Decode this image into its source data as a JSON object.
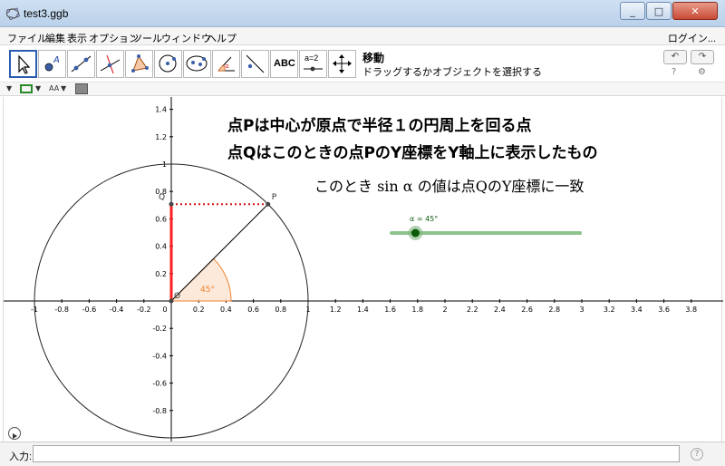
{
  "window": {
    "title": "test3.ggb",
    "minimize": "_",
    "maximize": "□",
    "close": "✕"
  },
  "menu": {
    "items": [
      "ファイル",
      "編集",
      "表示",
      "オプション",
      "ツール",
      "ウィンドウ",
      "ヘルプ"
    ],
    "login": "ログイン..."
  },
  "toolbar": {
    "active_tool_name": "移動",
    "active_tool_help": "ドラッグするかオブジェクトを選択する",
    "text_tool_label": "ABC",
    "slider_tool_label": "a=2",
    "undo": "↶",
    "redo": "↷",
    "tools": [
      "move-tool",
      "point-tool",
      "line-tool",
      "perpendicular-tool",
      "polygon-tool",
      "circle-tool",
      "ellipse-tool",
      "angle-tool",
      "reflect-tool",
      "text-tool",
      "slider-tool",
      "move-graphics-tool"
    ]
  },
  "stylebar": {
    "font_size_label": "AA"
  },
  "graphics": {
    "heading_line1": "点Pは中心が原点で半径１の円周上を回る点",
    "heading_line2": "点Qはこのときの点PのY座標をY軸上に表示したもの",
    "subheading": "このとき sin α の値は点QのY座標に一致",
    "slider_label": "α = 45°",
    "slider_value_deg": 45,
    "slider_min_deg": 0,
    "slider_max_deg": 360,
    "angle_label": "45°",
    "point_p_label": "P",
    "point_q_label": "Q",
    "origin_label": "O",
    "x_ticks": [
      "-1",
      "-0.8",
      "-0.6",
      "-0.4",
      "-0.2",
      "0",
      "0.2",
      "0.4",
      "0.6",
      "0.8",
      "1",
      "1.2",
      "1.4",
      "1.6",
      "1.8",
      "2",
      "2.2",
      "2.4",
      "2.6",
      "2.8",
      "3",
      "3.2",
      "3.4",
      "3.6",
      "3.8"
    ],
    "y_ticks": [
      "1.4",
      "1.2",
      "1",
      "0.8",
      "0.6",
      "0.4",
      "0.2",
      "-0.2",
      "-0.4",
      "-0.6",
      "-0.8"
    ],
    "colors": {
      "circle": "#222222",
      "segment_q": "#ff2020",
      "dotted": "#d81010",
      "angle": "#f08030",
      "slider_track": "#8cc48c",
      "slider_knob": "#0a5a0a"
    }
  },
  "inputbar": {
    "label": "入力:",
    "value": ""
  }
}
